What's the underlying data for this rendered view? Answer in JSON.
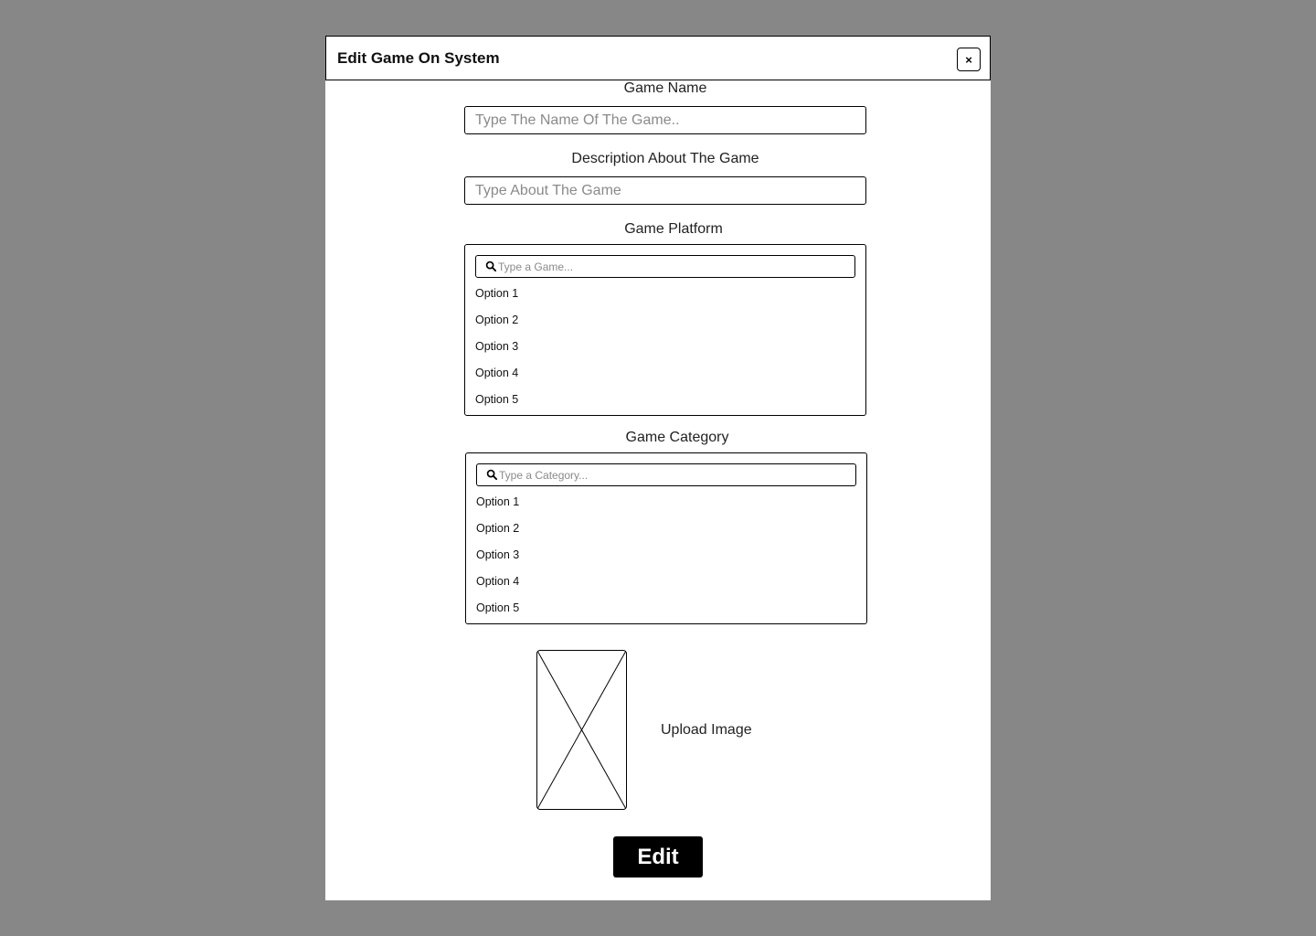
{
  "modal": {
    "title": "Edit Game On System",
    "close_label": "×"
  },
  "game_name": {
    "label": "Game Name",
    "placeholder": "Type The Name Of The Game.."
  },
  "description": {
    "label": "Description About The Game",
    "placeholder": "Type About The Game"
  },
  "platform": {
    "label": "Game Platform",
    "search_placeholder": "Type a Game...",
    "options": [
      "Option 1",
      "Option 2",
      "Option 3",
      "Option 4",
      "Option 5"
    ]
  },
  "category": {
    "label": "Game Category",
    "search_placeholder": "Type a Category...",
    "options": [
      "Option 1",
      "Option 2",
      "Option 3",
      "Option 4",
      "Option 5"
    ]
  },
  "upload": {
    "label": "Upload Image"
  },
  "submit": {
    "label": "Edit"
  },
  "colors": {
    "backdrop": "#878787",
    "modal_bg": "#ffffff",
    "button_bg": "#000000",
    "button_text": "#ffffff"
  }
}
